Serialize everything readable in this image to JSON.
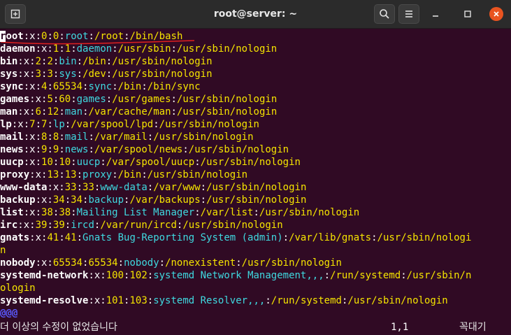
{
  "window": {
    "title": "root@server: ~",
    "new_tab_icon": "new-tab-icon",
    "search_icon": "search-icon",
    "menu_icon": "hamburger-menu-icon",
    "minimize_icon": "minimize-icon",
    "maximize_icon": "maximize-icon",
    "close_icon": "close-icon",
    "accent": "#e95420"
  },
  "terminal": {
    "background": "#300a24",
    "colors": {
      "user": "#ffffff",
      "separator": "#ffffff",
      "field": "#f5e400",
      "description": "#3fd9e0"
    },
    "cursor_char": "r",
    "lines": [
      {
        "user": "root",
        "sep": ":x:",
        "uid": "0",
        "gid": "0",
        "gecos": "root",
        "home": "/root",
        "shell": "/bin/bash"
      },
      {
        "user": "daemon",
        "sep": ":x:",
        "uid": "1",
        "gid": "1",
        "gecos": "daemon",
        "home": "/usr/sbin",
        "shell": "/usr/sbin/nologin"
      },
      {
        "user": "bin",
        "sep": ":x:",
        "uid": "2",
        "gid": "2",
        "gecos": "bin",
        "home": "/bin",
        "shell": "/usr/sbin/nologin"
      },
      {
        "user": "sys",
        "sep": ":x:",
        "uid": "3",
        "gid": "3",
        "gecos": "sys",
        "home": "/dev",
        "shell": "/usr/sbin/nologin"
      },
      {
        "user": "sync",
        "sep": ":x:",
        "uid": "4",
        "gid": "65534",
        "gecos": "sync",
        "home": "/bin",
        "shell": "/bin/sync"
      },
      {
        "user": "games",
        "sep": ":x:",
        "uid": "5",
        "gid": "60",
        "gecos": "games",
        "home": "/usr/games",
        "shell": "/usr/sbin/nologin"
      },
      {
        "user": "man",
        "sep": ":x:",
        "uid": "6",
        "gid": "12",
        "gecos": "man",
        "home": "/var/cache/man",
        "shell": "/usr/sbin/nologin"
      },
      {
        "user": "lp",
        "sep": ":x:",
        "uid": "7",
        "gid": "7",
        "gecos": "lp",
        "home": "/var/spool/lpd",
        "shell": "/usr/sbin/nologin"
      },
      {
        "user": "mail",
        "sep": ":x:",
        "uid": "8",
        "gid": "8",
        "gecos": "mail",
        "home": "/var/mail",
        "shell": "/usr/sbin/nologin"
      },
      {
        "user": "news",
        "sep": ":x:",
        "uid": "9",
        "gid": "9",
        "gecos": "news",
        "home": "/var/spool/news",
        "shell": "/usr/sbin/nologin"
      },
      {
        "user": "uucp",
        "sep": ":x:",
        "uid": "10",
        "gid": "10",
        "gecos": "uucp",
        "home": "/var/spool/uucp",
        "shell": "/usr/sbin/nologin"
      },
      {
        "user": "proxy",
        "sep": ":x:",
        "uid": "13",
        "gid": "13",
        "gecos": "proxy",
        "home": "/bin",
        "shell": "/usr/sbin/nologin"
      },
      {
        "user": "www-data",
        "sep": ":x:",
        "uid": "33",
        "gid": "33",
        "gecos": "www-data",
        "home": "/var/www",
        "shell": "/usr/sbin/nologin"
      },
      {
        "user": "backup",
        "sep": ":x:",
        "uid": "34",
        "gid": "34",
        "gecos": "backup",
        "home": "/var/backups",
        "shell": "/usr/sbin/nologin"
      },
      {
        "user": "list",
        "sep": ":x:",
        "uid": "38",
        "gid": "38",
        "gecos": "Mailing List Manager",
        "home": "/var/list",
        "shell": "/usr/sbin/nologin"
      },
      {
        "user": "irc",
        "sep": ":x:",
        "uid": "39",
        "gid": "39",
        "gecos": "ircd",
        "home": "/var/run/ircd",
        "shell": "/usr/sbin/nologin"
      },
      {
        "user": "gnats",
        "sep": ":x:",
        "uid": "41",
        "gid": "41",
        "gecos": "Gnats Bug-Reporting System (admin)",
        "home": "/var/lib/gnats",
        "shell": "/usr/sbin/nologi",
        "wrap": "n"
      },
      {
        "user": "nobody",
        "sep": ":x:",
        "uid": "65534",
        "gid": "65534",
        "gecos": "nobody",
        "home": "/nonexistent",
        "shell": "/usr/sbin/nologin"
      },
      {
        "user": "systemd-network",
        "sep": ":x:",
        "uid": "100",
        "gid": "102",
        "gecos": "systemd Network Management,,,",
        "home": "/run/systemd",
        "shell": "/usr/sbin/n",
        "wrap": "ologin"
      },
      {
        "user": "systemd-resolve",
        "sep": ":x:",
        "uid": "101",
        "gid": "103",
        "gecos": "systemd Resolver,,,",
        "home": "/run/systemd",
        "shell": "/usr/sbin/nologin"
      }
    ],
    "filler": "@@@",
    "status_message": "더 이상의 수정이 없었습니다",
    "cursor_position": "1,1",
    "scroll_position": "꼭대기",
    "annotation_color": "#e02020"
  }
}
